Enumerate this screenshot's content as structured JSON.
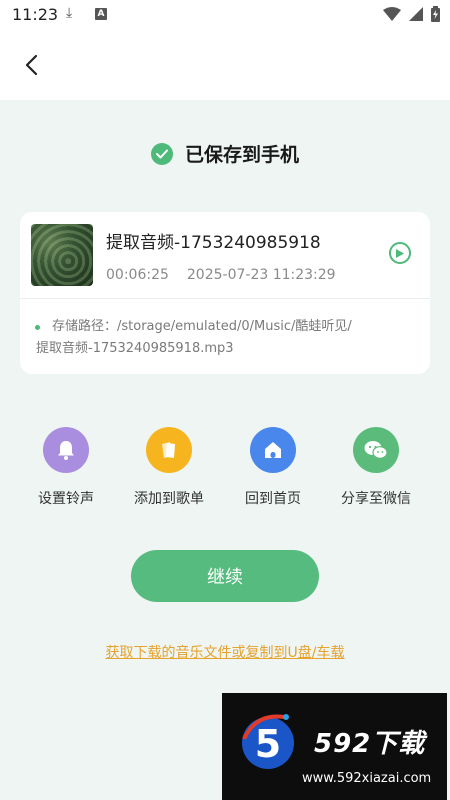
{
  "status": {
    "time": "11:23",
    "download_glyph": "⤓",
    "app_glyph": "A"
  },
  "header": {
    "back_icon": "chevron-left-icon"
  },
  "saved": {
    "text": "已保存到手机",
    "icon": "check-circle-icon",
    "color": "#4dba7a"
  },
  "track": {
    "title": "提取音频-1753240985918",
    "duration": "00:06:25",
    "timestamp": "2025-07-23 11:23:29",
    "path_label": "存储路径：/storage/emulated/0/Music/酷蛙听见/",
    "path_file": "提取音频-1753240985918.mp3"
  },
  "actions": [
    {
      "label": "设置铃声",
      "icon": "bell-icon",
      "color": "#a98ee0"
    },
    {
      "label": "添加到歌单",
      "icon": "playlist-add-icon",
      "color": "#f6b51e"
    },
    {
      "label": "回到首页",
      "icon": "home-icon",
      "color": "#4a87ec"
    },
    {
      "label": "分享至微信",
      "icon": "wechat-icon",
      "color": "#5bbb7b"
    }
  ],
  "continue_label": "继续",
  "link_text": "获取下载的音乐文件或复制到U盘/车载",
  "watermark": {
    "brand": "592下载",
    "logo_digit": "5",
    "url": "www.592xiazai.com"
  },
  "colors": {
    "accent": "#55bb7e",
    "link": "#e6a22c",
    "background": "#eef5f3"
  }
}
